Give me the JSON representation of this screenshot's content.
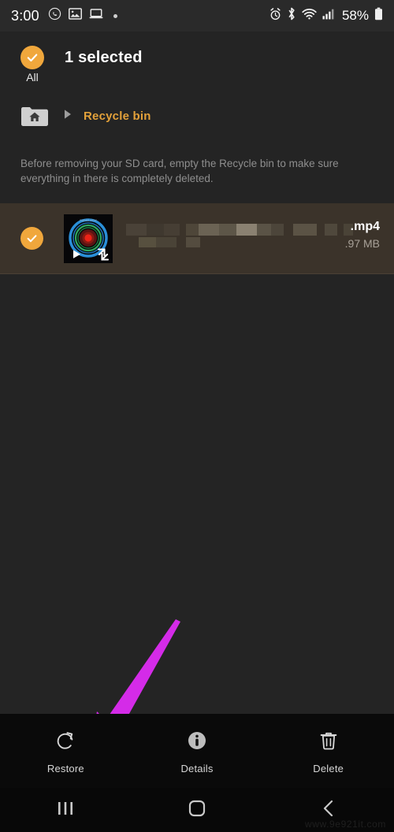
{
  "status_bar": {
    "time": "3:00",
    "battery_percent": "58%",
    "left_icons": [
      "whatsapp-icon",
      "gallery-icon",
      "laptop-icon",
      "notification-dot"
    ],
    "right_icons": [
      "alarm-icon",
      "bluetooth-icon",
      "wifi-icon",
      "signal-icon",
      "battery-icon"
    ]
  },
  "header": {
    "selected_label": "1 selected",
    "all_label": "All",
    "check_color": "#f0a73c"
  },
  "breadcrumb": {
    "home_icon": "home-folder-icon",
    "separator_icon": "chevron-right-icon",
    "current": "Recycle bin",
    "accent_color": "#e3a13a"
  },
  "note": {
    "text": "Before removing your SD card, empty the Recycle bin to make sure everything in there is completely deleted."
  },
  "file_row": {
    "selected": true,
    "thumbnail": "video-thumbnail-concentric-rings",
    "name_suffix": ".mp4",
    "size": ".97 MB",
    "name_censored": true,
    "row_background": "#3b332a"
  },
  "annotation": {
    "arrow_color": "#d42be8",
    "points_to": "Restore"
  },
  "action_bar": {
    "items": [
      {
        "label": "Restore",
        "icon": "restore-icon"
      },
      {
        "label": "Details",
        "icon": "info-icon"
      },
      {
        "label": "Delete",
        "icon": "trash-icon"
      }
    ]
  },
  "nav_bar": {
    "items": [
      {
        "icon": "recents-icon"
      },
      {
        "icon": "home-icon"
      },
      {
        "icon": "back-icon"
      }
    ]
  },
  "watermark": {
    "text": "www.9e921it.com"
  }
}
